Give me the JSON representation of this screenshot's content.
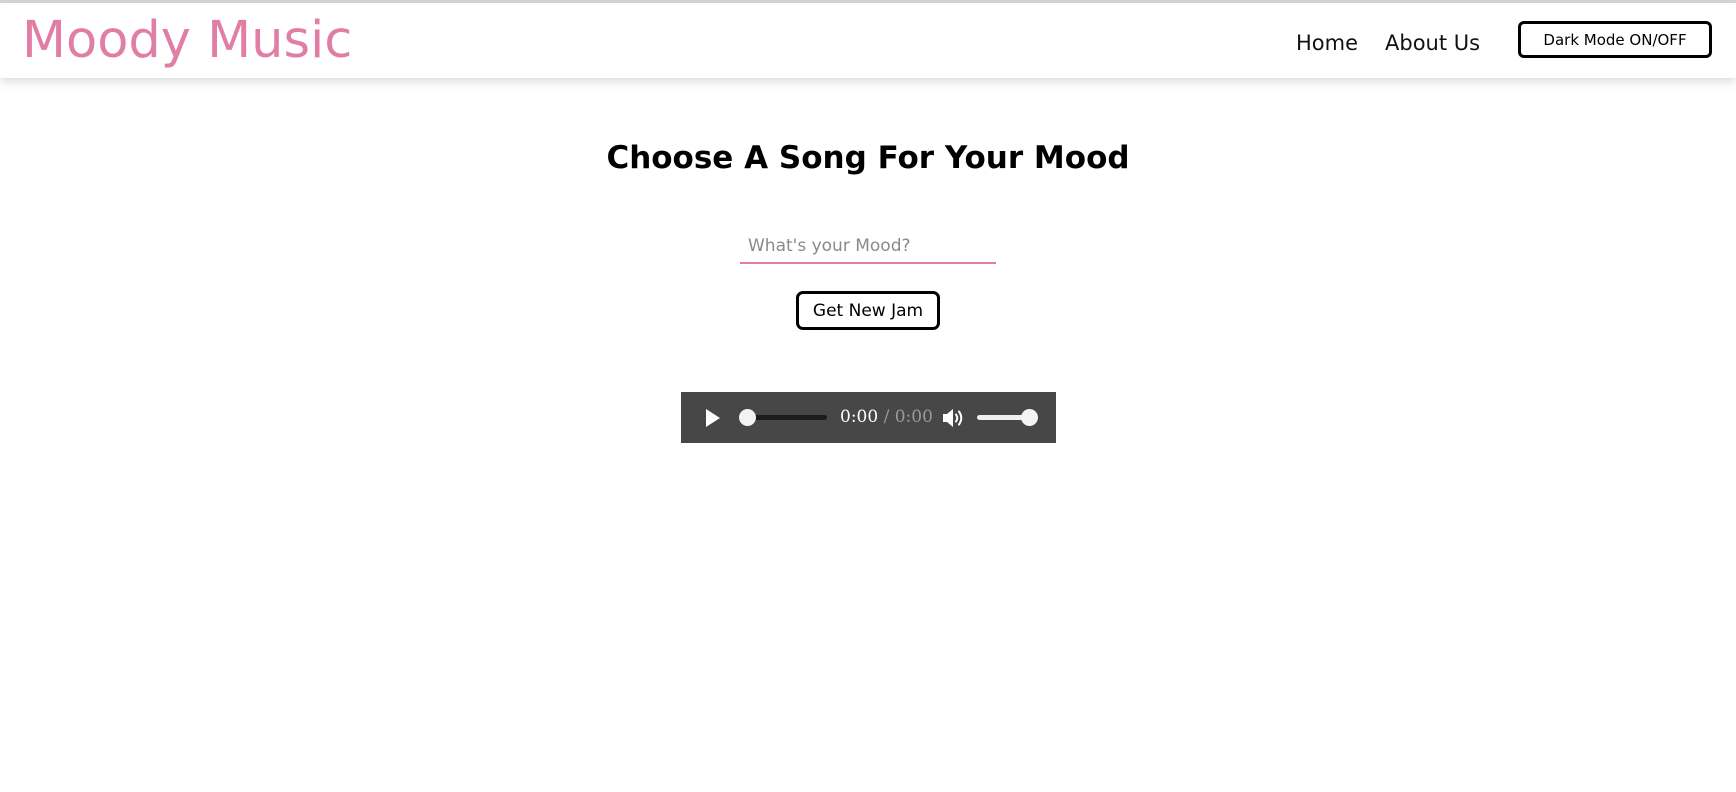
{
  "app": {
    "logo": "Moody Music",
    "brand_color": "#e07ea5"
  },
  "nav": {
    "items": [
      {
        "label": "Home"
      },
      {
        "label": "About Us"
      }
    ],
    "dark_mode_label": "Dark Mode ON/OFF"
  },
  "main": {
    "title": "Choose A Song For Your Mood",
    "mood_input": {
      "placeholder": "What's your Mood?",
      "value": ""
    },
    "get_jam_label": "Get New Jam"
  },
  "player": {
    "current_time": "0:00",
    "separator": " / ",
    "duration": "0:00",
    "progress": 0,
    "volume": 1.0,
    "icons": {
      "play": "play-icon",
      "volume": "volume-icon"
    }
  }
}
